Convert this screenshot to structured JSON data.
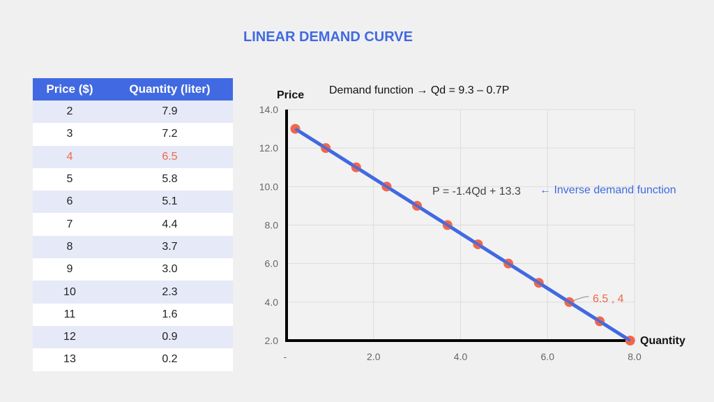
{
  "title": "LINEAR DEMAND CURVE",
  "table": {
    "headers": [
      "Price ($)",
      "Quantity (liter)"
    ],
    "rows": [
      [
        "2",
        "7.9"
      ],
      [
        "3",
        "7.2"
      ],
      [
        "4",
        "6.5"
      ],
      [
        "5",
        "5.8"
      ],
      [
        "6",
        "5.1"
      ],
      [
        "7",
        "4.4"
      ],
      [
        "8",
        "3.7"
      ],
      [
        "9",
        "3.0"
      ],
      [
        "10",
        "2.3"
      ],
      [
        "11",
        "1.6"
      ],
      [
        "12",
        "0.9"
      ],
      [
        "13",
        "0.2"
      ]
    ],
    "highlight_row": 2
  },
  "colors": {
    "accent": "#4169e1",
    "highlight": "#f0674a",
    "point": "#f0674a",
    "line": "#4169e1"
  },
  "chart_data": {
    "type": "scatter",
    "title": "Demand function → Qd = 9.3 – 0.7P",
    "xlabel": "Quantity",
    "ylabel": "Price",
    "xlim": [
      0,
      8
    ],
    "ylim": [
      2,
      14
    ],
    "xticks": [
      "-",
      "2.0",
      "4.0",
      "6.0",
      "8.0"
    ],
    "xtick_values": [
      0,
      2,
      4,
      6,
      8
    ],
    "yticks": [
      "2.0",
      "4.0",
      "6.0",
      "8.0",
      "10.0",
      "12.0",
      "14.0"
    ],
    "ytick_values": [
      2,
      4,
      6,
      8,
      10,
      12,
      14
    ],
    "grid": true,
    "series": [
      {
        "name": "Demand",
        "x": [
          7.9,
          7.2,
          6.5,
          5.8,
          5.1,
          4.4,
          3.7,
          3.0,
          2.3,
          1.6,
          0.9,
          0.2
        ],
        "y": [
          2,
          3,
          4,
          5,
          6,
          7,
          8,
          9,
          10,
          11,
          12,
          13
        ]
      }
    ],
    "annotations": {
      "inverse_formula": "P = -1.4Qd + 13.3",
      "inverse_label": "← Inverse demand function",
      "point_label": "6.5 , 4"
    }
  }
}
